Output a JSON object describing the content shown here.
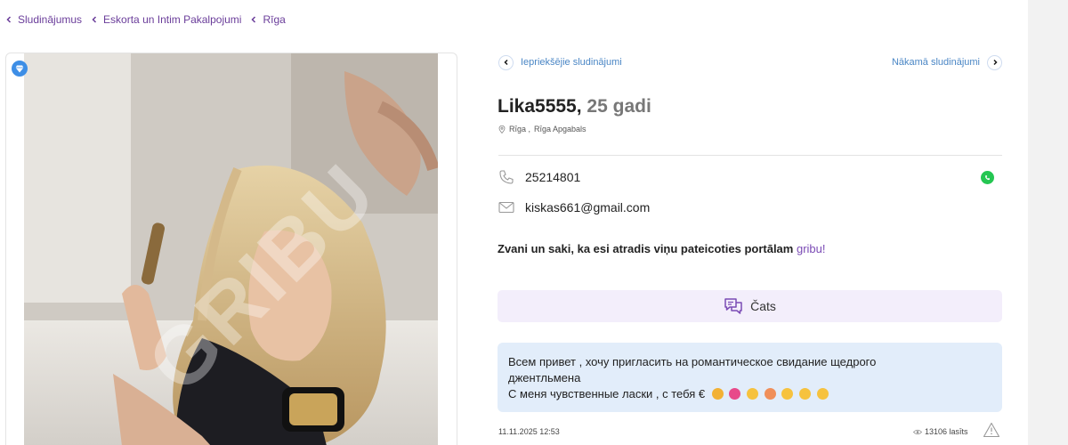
{
  "breadcrumb": [
    {
      "label": "Sludinājumus"
    },
    {
      "label": "Eskorta un Intim Pakalpojumi"
    },
    {
      "label": "Rīga"
    }
  ],
  "nav": {
    "prev_label": "Iepriekšējie sludinājumi",
    "next_label": "Nākamā sludinājumi"
  },
  "listing": {
    "name": "Lika5555,",
    "age": "25 gadi",
    "location_city": "Rīga ,",
    "location_region": "Rīga Apgabals",
    "phone": "25214801",
    "email": "kiskas661@gmail.com",
    "cta_text": "Zvani un saki, ka esi atradis viņu pateicoties portālam ",
    "cta_link": "gribu!",
    "chat_label": "Čats",
    "description_line1": "Всем привет , хочу пригласить на романтическое свидание щедрого",
    "description_line2": "джентльмена",
    "description_line3": "С меня чувственные ласки , с тебя €",
    "date": "11.11.2025 12:53",
    "views": "13106 lasīts"
  },
  "photo": {
    "watermark": "GRIBU"
  },
  "icons": {
    "breadcrumb": "chevron-left-icon",
    "badge": "diamond-icon",
    "prev": "chevron-left-icon",
    "next": "chevron-right-icon",
    "location": "location-pin-icon",
    "phone": "phone-icon",
    "email": "mail-icon",
    "whatsapp": "whatsapp-icon",
    "chat": "chat-bubbles-icon",
    "views": "eye-icon",
    "report": "warning-triangle-icon"
  },
  "colors": {
    "accent": "#7b4bb5",
    "breadcrumb": "#6a3d9a",
    "link_blue": "#4a86c5",
    "chat_bg": "#f3eefb",
    "desc_bg": "#e2edfa",
    "whatsapp": "#25c652"
  }
}
